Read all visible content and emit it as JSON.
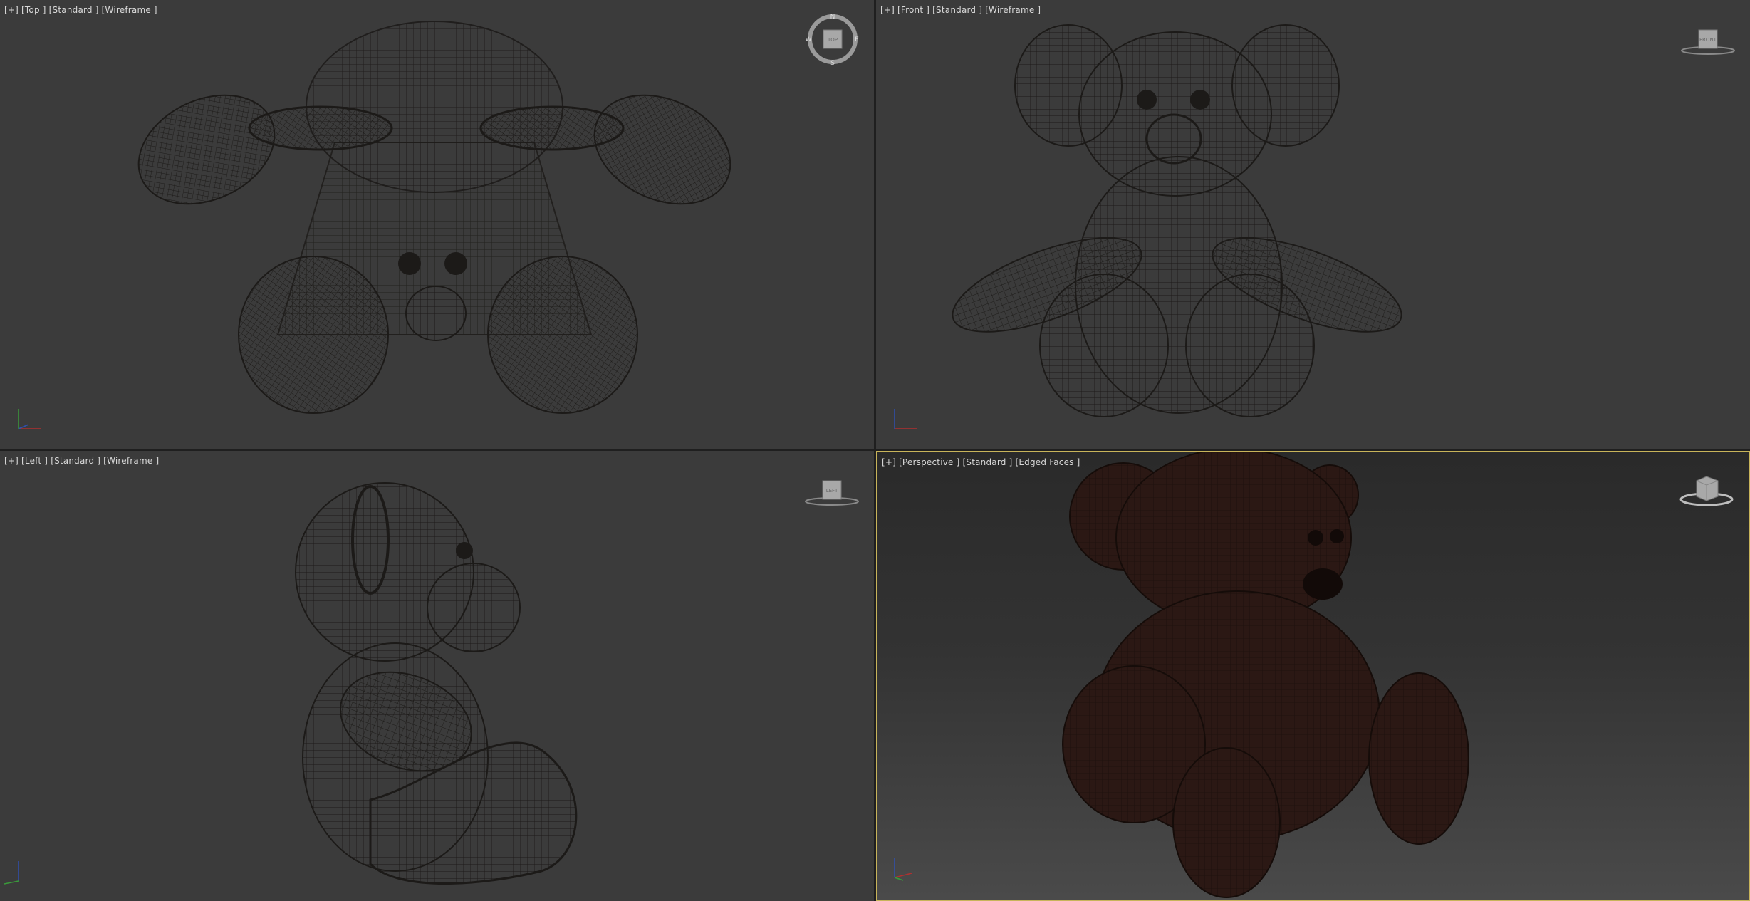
{
  "viewports": [
    {
      "id": "top",
      "label": "[+] [Top ] [Standard ] [Wireframe ]",
      "viewcube": "TOP",
      "compass": {
        "n": "N",
        "s": "S",
        "e": "E",
        "w": "W"
      }
    },
    {
      "id": "front",
      "label": "[+] [Front ] [Standard ] [Wireframe ]",
      "viewcube": "FRONT"
    },
    {
      "id": "left",
      "label": "[+] [Left ] [Standard ] [Wireframe ]",
      "viewcube": "LEFT"
    },
    {
      "id": "perspective",
      "label": "[+] [Perspective ] [Standard ] [Edged Faces ]",
      "viewcube": "",
      "active": true
    }
  ],
  "colors": {
    "viewport_bg": "#3b3b3b",
    "active_border": "#c8b45a",
    "wire": "#1c1a18",
    "fur": "#4a2a18",
    "mesh_shade": "#2b1814"
  },
  "icons": {
    "axis_tripod": "axis-tripod-icon",
    "viewcube": "viewcube-icon",
    "compass": "compass-icon"
  }
}
